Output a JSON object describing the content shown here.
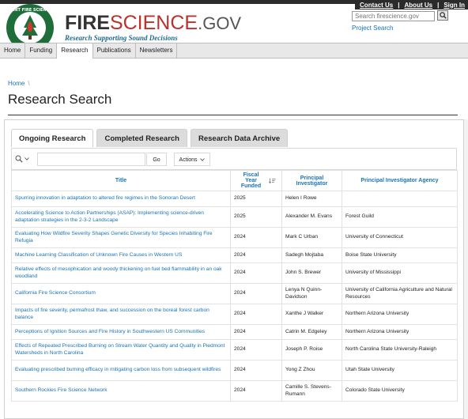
{
  "header": {
    "brand_fire": "FIRE",
    "brand_science": "SCIENCE",
    "brand_gov": ".GOV",
    "tagline": "Research Supporting Sound Decisions",
    "seal_text": "JOINT FIRE SCIENCE PROGRAM",
    "utility_links": [
      "Contact Us",
      "About Us",
      "Sign In"
    ],
    "search_placeholder": "Search firescience.gov",
    "project_search": "Project Search"
  },
  "nav": {
    "items": [
      "Home",
      "Funding",
      "Research",
      "Publications",
      "Newsletters"
    ],
    "active": "Research"
  },
  "breadcrumb": {
    "home": "Home",
    "separator": "\\"
  },
  "page_title": "Research Search",
  "tabs": [
    "Ongoing Research",
    "Completed Research",
    "Research Data Archive"
  ],
  "toolbar": {
    "go_label": "Go",
    "actions_label": "Actions"
  },
  "table": {
    "columns": [
      "Title",
      "Fiscal Year Funded",
      "Principal Investigator",
      "Principal Investigator Agency"
    ],
    "rows": [
      [
        "Spurring innovation in adaptation to altered fire regimes in the Sonoran Desert",
        "2025",
        "Helen I Rowe",
        ""
      ],
      [
        "Accelerating Science to Action Partnerships (ASAP): Implementing science-driven adaptation strategies in the 2-3-2 Landscape",
        "2025",
        "Alexander M. Evans",
        "Forest Guild"
      ],
      [
        "Evaluating How Wildfire Severity Shapes Genetic Diversity for Species Inhabiting Fire Refugia",
        "2024",
        "Mark C Urban",
        "University of Connecticut"
      ],
      [
        "Machine Learning Classification of Unknown Fire Causes in Western US",
        "2024",
        "Sadegh Mojtaba",
        "Boise State University"
      ],
      [
        "Relative effects of mesophication and woody thickening on fuel bed flammability in an oak woodland",
        "2024",
        "John S. Brewer",
        "University of Mississippi"
      ],
      [
        "California Fire Science Consortium",
        "2024",
        "Lenya N Quinn-Davidson",
        "University of California Agriculture and Natural Resources"
      ],
      [
        "Impacts of fire severity, permafrost thaw, and succession on the boreal forest carbon balance",
        "2024",
        "Xanthe J Walker",
        "Northern Arizona University"
      ],
      [
        "Perceptions of Ignition Sources and Fire History in Southwestern US Communities",
        "2024",
        "Catrin M. Edgeley",
        "Northern Arizona University"
      ],
      [
        "Effects of Repeated Prescribed Burning on Stream Water Quantity and Quality in Piedmont Watersheds in North Carolina",
        "2024",
        "Joseph P. Roise",
        "North Carolina State University-Raleigh"
      ],
      [
        "Evaluating prescribed burning efficacy in mitigating carbon loss from subsequent wildfires",
        "2024",
        "Yong Z Zhou",
        "Utah State University"
      ],
      [
        "Southern Rockies Fire Science Network",
        "2024",
        "Camille S. Stevens-Rumann",
        "Colorado State University"
      ]
    ]
  },
  "colors": {
    "link": "#1a73b5",
    "brand_red": "#c0302b",
    "dark_bar": "#2b2b2b",
    "nav_bg": "#e8e8e8",
    "tab_inactive": "#dcdcdc"
  }
}
